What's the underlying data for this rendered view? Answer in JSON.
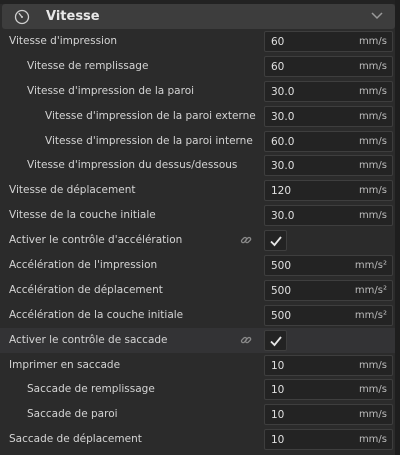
{
  "section": {
    "title": "Vitesse",
    "icon": "gauge-icon",
    "collapse_icon": "chevron-down-icon"
  },
  "settings": [
    {
      "label": "Vitesse d'impression",
      "value": "60",
      "unit": "mm/s"
    },
    {
      "label": "Vitesse de remplissage",
      "value": "60",
      "unit": "mm/s"
    },
    {
      "label": "Vitesse d'impression de la paroi",
      "value": "30.0",
      "unit": "mm/s"
    },
    {
      "label": "Vitesse d'impression de la paroi externe",
      "value": "30.0",
      "unit": "mm/s"
    },
    {
      "label": "Vitesse d'impression de la paroi interne",
      "value": "60.0",
      "unit": "mm/s"
    },
    {
      "label": "Vitesse d'impression du dessus/dessous",
      "value": "30.0",
      "unit": "mm/s"
    },
    {
      "label": "Vitesse de déplacement",
      "value": "120",
      "unit": "mm/s"
    },
    {
      "label": "Vitesse de la couche initiale",
      "value": "30.0",
      "unit": "mm/s"
    },
    {
      "label": "Activer le contrôle d'accélération",
      "checked": true
    },
    {
      "label": "Accélération de l'impression",
      "value": "500",
      "unit": "mm/s²"
    },
    {
      "label": "Accélération de déplacement",
      "value": "500",
      "unit": "mm/s²"
    },
    {
      "label": "Accélération de la couche initiale",
      "value": "500",
      "unit": "mm/s²"
    },
    {
      "label": "Activer le contrôle de saccade",
      "checked": true
    },
    {
      "label": "Imprimer en saccade",
      "value": "10",
      "unit": "mm/s"
    },
    {
      "label": "Saccade de remplissage",
      "value": "10",
      "unit": "mm/s"
    },
    {
      "label": "Saccade de paroi",
      "value": "10",
      "unit": "mm/s"
    },
    {
      "label": "Saccade de déplacement",
      "value": "10",
      "unit": "mm/s"
    }
  ]
}
